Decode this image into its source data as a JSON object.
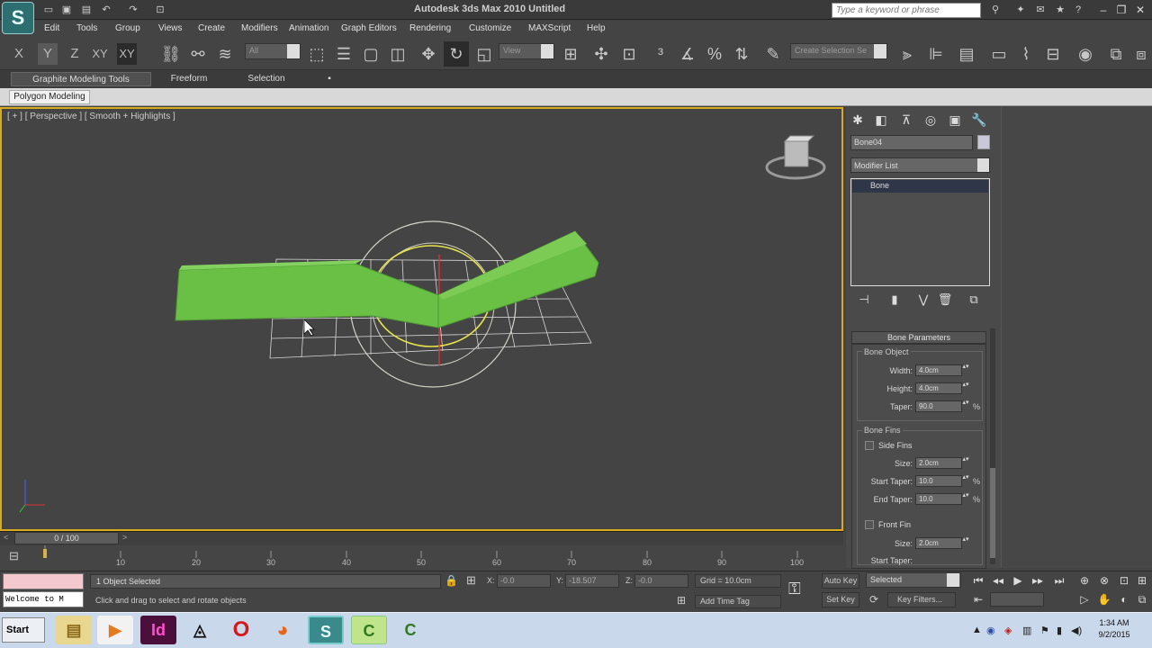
{
  "window": {
    "title": "Autodesk 3ds Max  2010     Untitled",
    "search_placeholder": "Type a keyword or phrase",
    "logo_letter": "S"
  },
  "menu": [
    "Edit",
    "Tools",
    "Group",
    "Views",
    "Create",
    "Modifiers",
    "Animation",
    "Graph Editors",
    "Rendering",
    "Customize",
    "MAXScript",
    "Help"
  ],
  "toolbar": {
    "axes": [
      "X",
      "Y",
      "Z",
      "XY",
      "XY"
    ],
    "filter_value": "All",
    "ref_coord_value": "View",
    "selection_set_placeholder": "Create Selection Se"
  },
  "ribbon": {
    "tabs": [
      "Graphite Modeling Tools",
      "Freeform",
      "Selection"
    ],
    "subtab": "Polygon Modeling"
  },
  "viewport": {
    "label": "[ + ] [ Perspective ] [ Smooth + Highlights ]",
    "object_color": "#6abf45",
    "border_color": "#d9a91e"
  },
  "command_panel": {
    "object_name": "Bone04",
    "modifier_list": "Modifier List",
    "stack_item": "Bone",
    "rollout_title": "Bone Parameters",
    "bone_object": {
      "title": "Bone Object",
      "width_label": "Width:",
      "width_value": "4.0cm",
      "height_label": "Height:",
      "height_value": "4.0cm",
      "taper_label": "Taper:",
      "taper_value": "90.0"
    },
    "bone_fins": {
      "title": "Bone Fins",
      "side_fins": "Side Fins",
      "size_label": "Size:",
      "size_value": "2.0cm",
      "start_taper_label": "Start Taper:",
      "start_taper_value": "10.0",
      "end_taper_label": "End Taper:",
      "end_taper_value": "10.0",
      "front_fin": "Front Fin",
      "front_size_label": "Size:",
      "front_size_value": "2.0cm",
      "front_start_taper_label": "Start Taper:"
    },
    "percent": "%"
  },
  "timeline": {
    "frame_display": "0 / 100",
    "ticks": [
      "10",
      "20",
      "30",
      "40",
      "50",
      "60",
      "70",
      "80",
      "90",
      "100"
    ]
  },
  "status": {
    "maxscript_output": "Welcome to M",
    "selection_info": "1 Object Selected",
    "prompt": "Click and drag to select and rotate objects",
    "x_label": "X:",
    "x_value": "-0.0",
    "y_label": "Y:",
    "y_value": "-18.507",
    "z_label": "Z:",
    "z_value": "-0.0",
    "grid": "Grid = 10.0cm",
    "add_time_tag": "Add Time Tag",
    "auto_key": "Auto Key",
    "set_key": "Set Key",
    "selected_dropdown": "Selected",
    "key_filters": "Key Filters..."
  },
  "taskbar": {
    "start": "Start",
    "time": "1:34 AM",
    "date": "9/2/2015"
  }
}
